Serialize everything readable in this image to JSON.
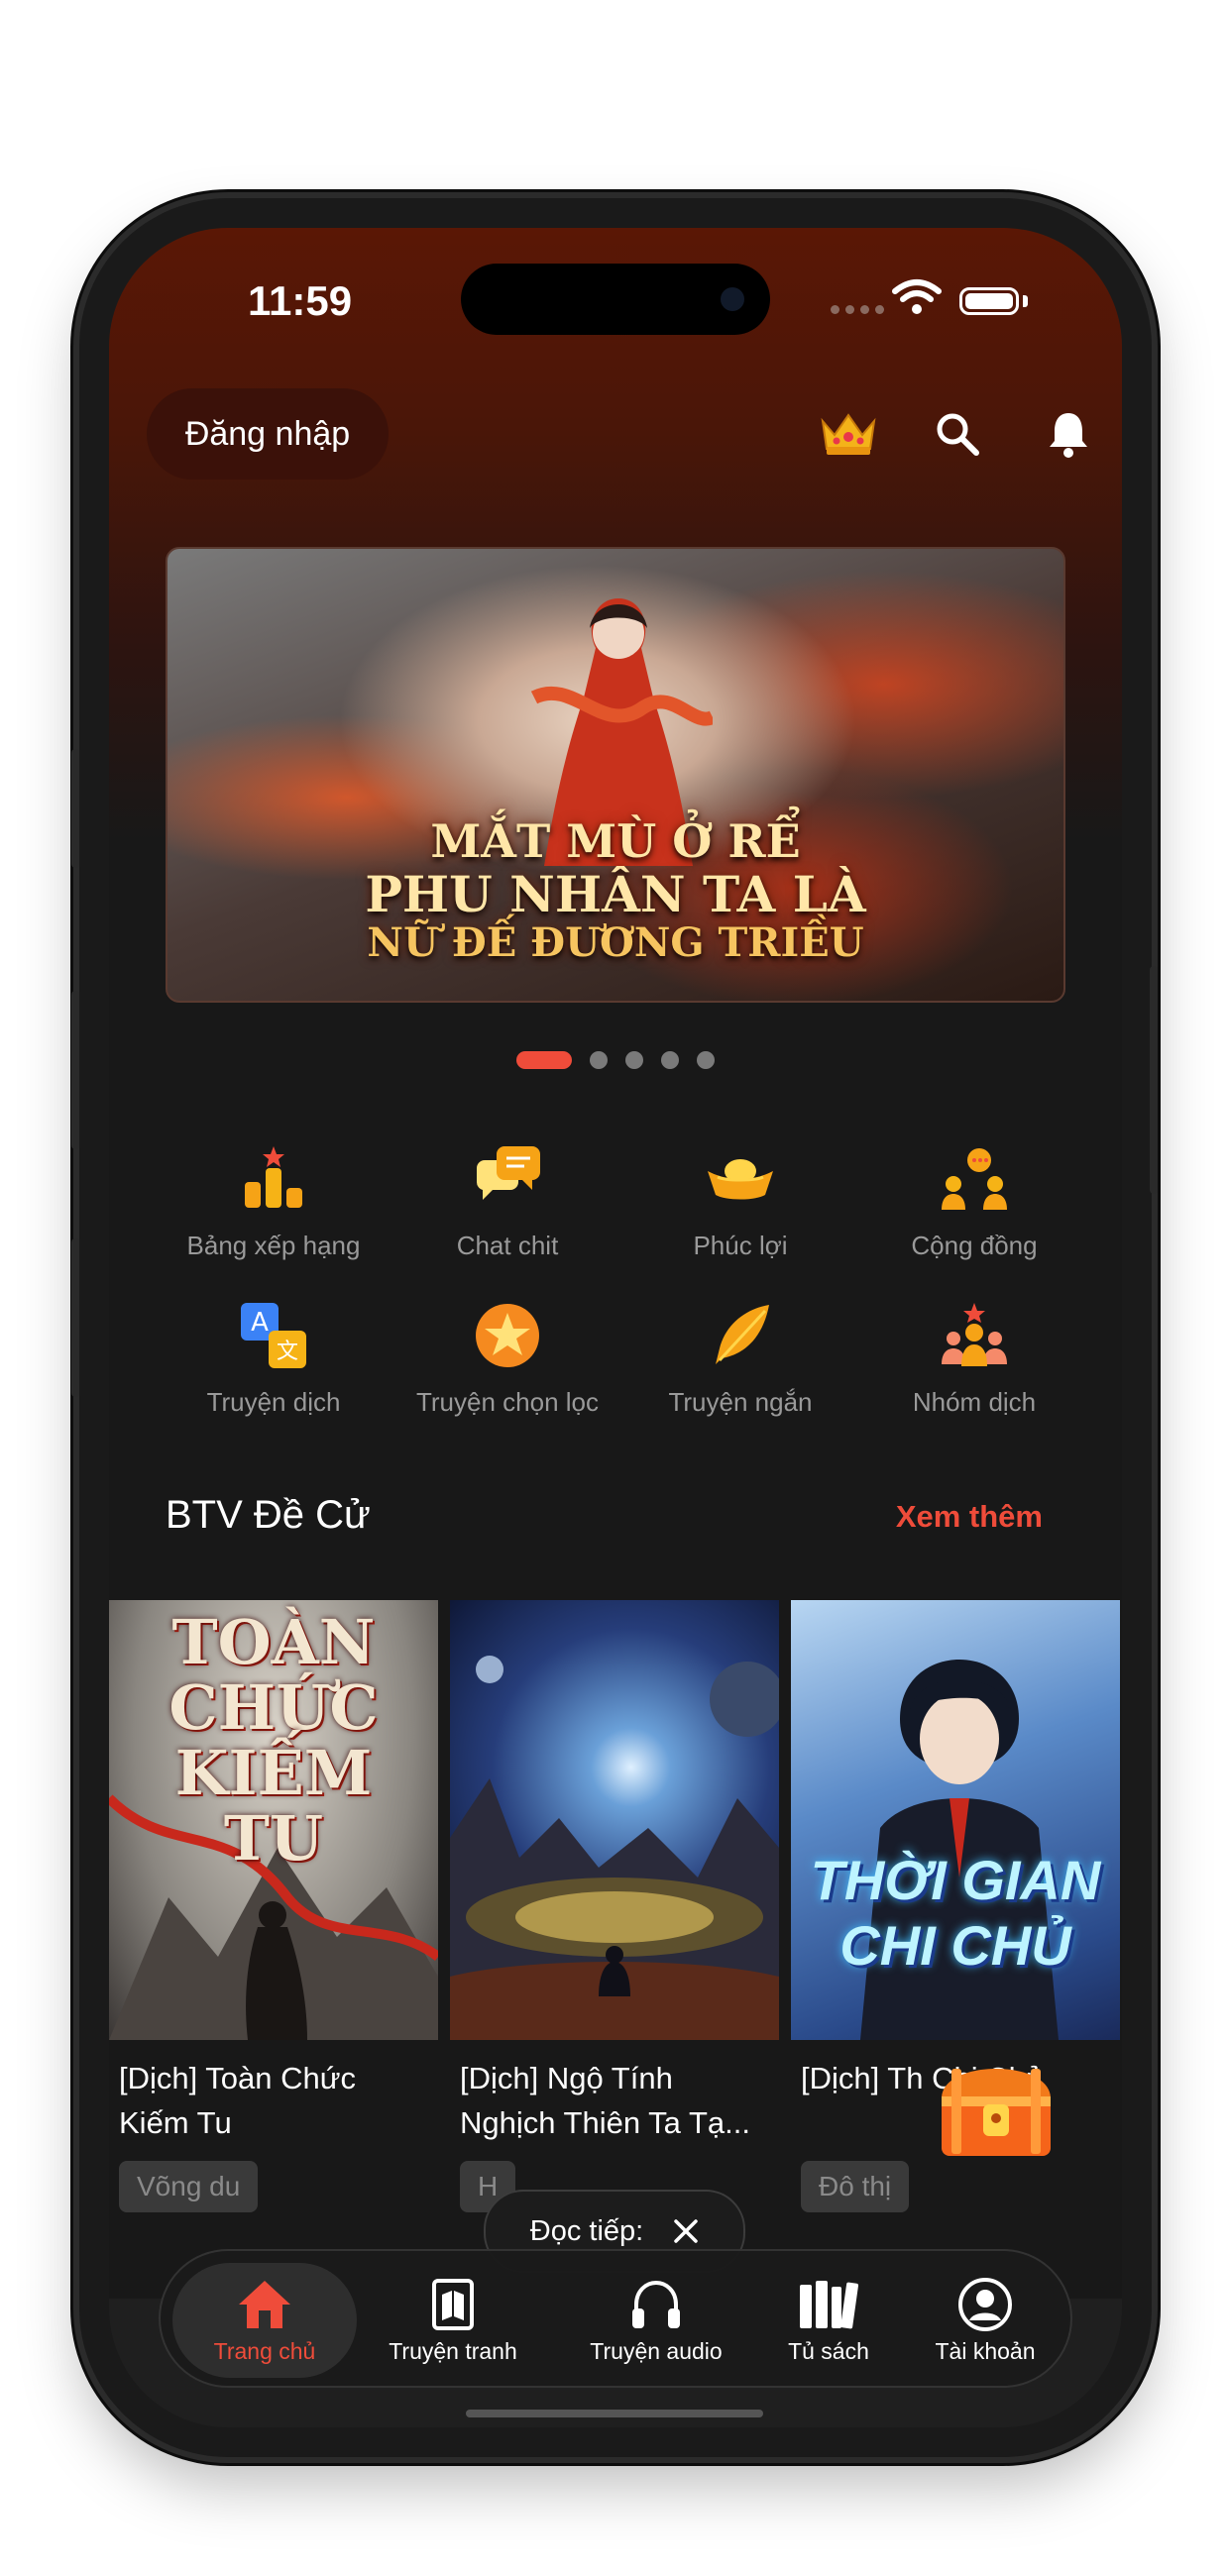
{
  "status_bar": {
    "time": "11:59"
  },
  "header": {
    "login_label": "Đăng nhập",
    "icons": [
      "crown-icon",
      "search-icon",
      "bell-icon"
    ]
  },
  "banner": {
    "title_lines": [
      "MẮT MÙ Ở RỂ",
      "PHU NHÂN TA LÀ",
      "NỮ ĐẾ ĐƯƠNG TRIỀU"
    ],
    "slides": 5,
    "active_slide": 1
  },
  "categories": [
    {
      "label": "Bảng xếp hạng",
      "icon": "ranking-icon"
    },
    {
      "label": "Chat chit",
      "icon": "chat-icon"
    },
    {
      "label": "Phúc lợi",
      "icon": "gold-ingot-icon"
    },
    {
      "label": "Cộng đồng",
      "icon": "community-icon"
    },
    {
      "label": "Truyện dịch",
      "icon": "translate-icon"
    },
    {
      "label": "Truyện chọn lọc",
      "icon": "star-icon"
    },
    {
      "label": "Truyện ngắn",
      "icon": "feather-icon"
    },
    {
      "label": "Nhóm dịch",
      "icon": "group-icon"
    }
  ],
  "section": {
    "title": "BTV Đề Cử",
    "see_more": "Xem thêm"
  },
  "books": [
    {
      "title": "[Dịch] Toàn Chức Kiếm Tu",
      "genre": "Võng du",
      "cover_text": [
        "TOÀN",
        "CHỨC",
        "KIẾM",
        "TU"
      ]
    },
    {
      "title": "[Dịch] Ngộ Tính Nghịch Thiên Ta Tạ...",
      "genre": "H",
      "cover_text": []
    },
    {
      "title": "[Dịch] Th Chi Chủ",
      "genre": "Đô thị",
      "cover_text": [
        "THỜI GIAN",
        "CHI CHỦ"
      ]
    }
  ],
  "continue_reading": {
    "label": "Đọc tiếp:"
  },
  "bottom_nav": [
    {
      "label": "Trang chủ",
      "icon": "home-icon",
      "active": true
    },
    {
      "label": "Truyện tranh",
      "icon": "comic-book-icon",
      "active": false
    },
    {
      "label": "Truyện audio",
      "icon": "headphones-icon",
      "active": false
    },
    {
      "label": "Tủ sách",
      "icon": "bookshelf-icon",
      "active": false
    },
    {
      "label": "Tài khoản",
      "icon": "account-icon",
      "active": false
    }
  ],
  "colors": {
    "accent": "#ef4c3a",
    "header_top": "#5a1705",
    "background": "#181818"
  }
}
